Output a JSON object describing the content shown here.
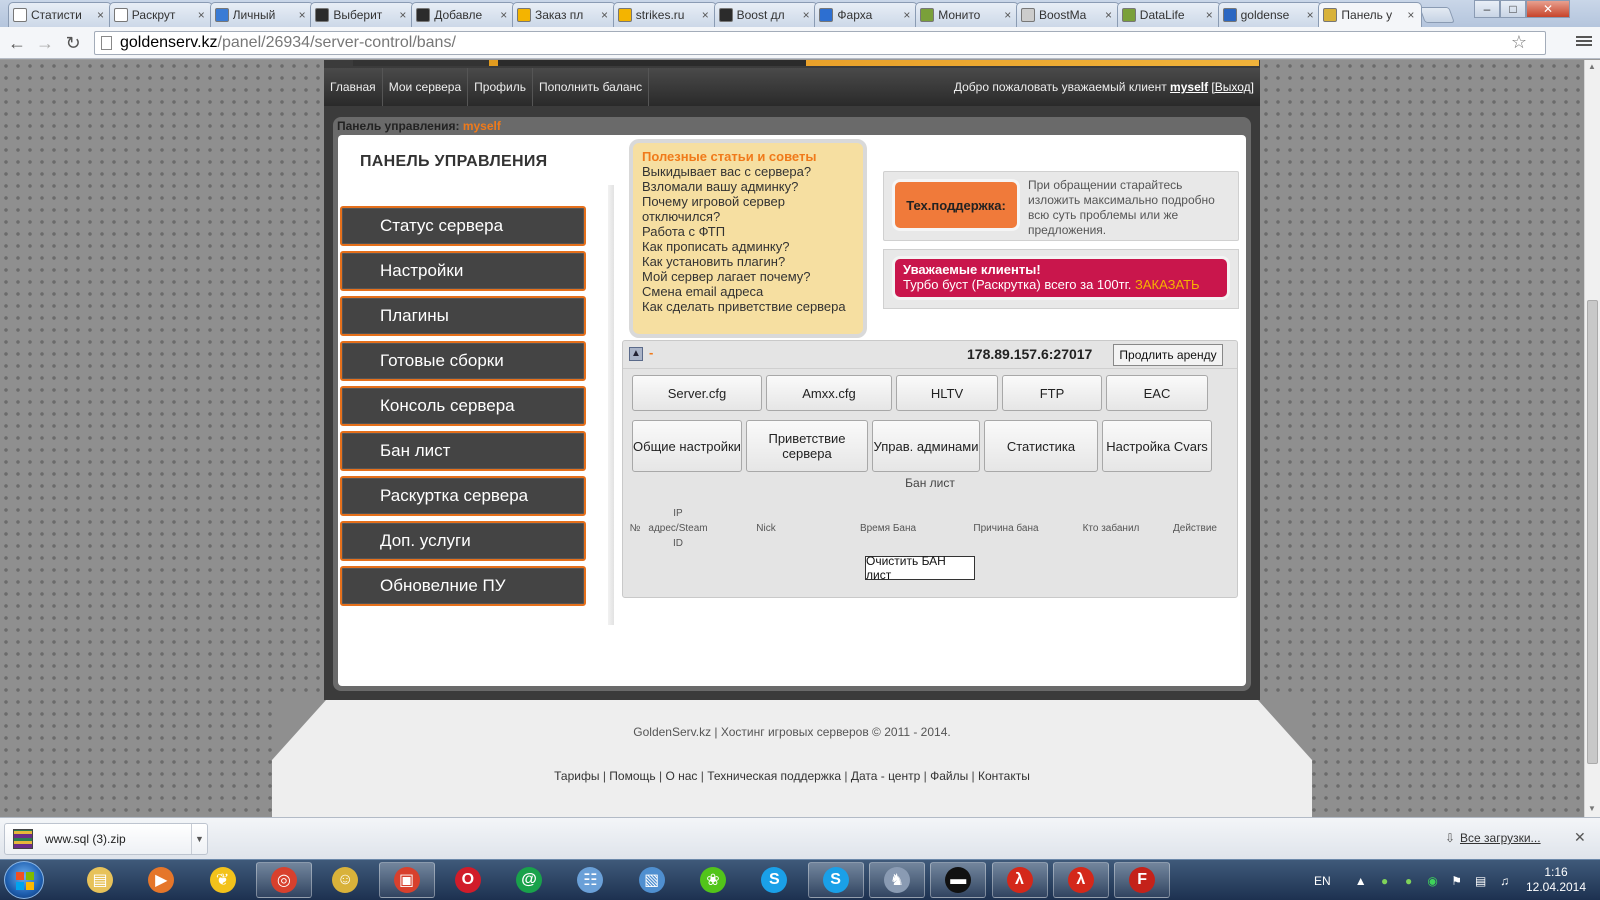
{
  "browser": {
    "tabs": [
      {
        "title": "Статисти",
        "fav": "page-icon",
        "color": "#ffffff"
      },
      {
        "title": "Раскрут",
        "fav": "page-icon",
        "color": "#ffffff"
      },
      {
        "title": "Личный",
        "fav": "folder-icon",
        "color": "#3a7bd5"
      },
      {
        "title": "Выберит",
        "fav": "cs-icon",
        "color": "#2b2b2b"
      },
      {
        "title": "Добавле",
        "fav": "cs-icon",
        "color": "#2b2b2b"
      },
      {
        "title": "Заказ пл",
        "fav": "google-icon",
        "color": "#f4b400"
      },
      {
        "title": "strikes.ru",
        "fav": "google-icon",
        "color": "#f4b400"
      },
      {
        "title": "Boost дл",
        "fav": "cs-icon",
        "color": "#2b2b2b"
      },
      {
        "title": "Фарха",
        "fav": "play-icon",
        "color": "#2d6fd1"
      },
      {
        "title": "Монито",
        "fav": "cs-green-icon",
        "color": "#7aa03a"
      },
      {
        "title": "BoostMa",
        "fav": "loading-icon",
        "color": "#cccccc"
      },
      {
        "title": "DataLife",
        "fav": "cs-green-icon",
        "color": "#7aa03a"
      },
      {
        "title": "goldense",
        "fav": "gs-icon",
        "color": "#2b67c2"
      },
      {
        "title": "Панель у",
        "fav": "cs-icon",
        "color": "#d8b23a"
      }
    ],
    "url_host": "goldenserv.kz",
    "url_path": "/panel/26934/server-control/bans/"
  },
  "site": {
    "nav": [
      "Главная",
      "Мои сервера",
      "Профиль",
      "Пополнить баланс"
    ],
    "welcome": "Добро пожаловать уважаемый клиент",
    "username": "myself",
    "logout": "[Выход]",
    "panel_header": "Панель управления:",
    "panel_user": "myself",
    "cp_title": "ПАНЕЛЬ УПРАВЛЕНИЯ",
    "side_menu": [
      "Статус сервера",
      "Настройки",
      "Плагины",
      "Готовые сборки",
      "Консоль сервера",
      "Бан лист",
      "Раскуртка сервера",
      "Доп. услуги",
      "Обновелние ПУ"
    ],
    "tips_title": "Полезные статьи и советы",
    "tips": [
      "Выкидывает вас с сервера?",
      "Взломали вашу админку?",
      "Почему игровой сервер отключился?",
      "Работа с ФТП",
      "Как прописать админку?",
      "Как установить плагин?",
      "Мой сервер лагает почему?",
      "Смена email адреса",
      "Как сделать приветствие сервера"
    ],
    "support_label": "Тех.поддержка:",
    "support_text": "При обращении старайтесь изложить максимально подробно всю суть проблемы или же предложения.",
    "promo_title": "Уважаемые клиенты!",
    "promo_text": "Турбо буст (Раскрутка) всего за 100тг.",
    "promo_order": "ЗАКАЗАТЬ",
    "server_dash": "-",
    "server_ip": "178.89.157.6:27017",
    "renew": "Продлить аренду",
    "row1": [
      "Server.cfg",
      "Amxx.cfg",
      "HLTV",
      "FTP",
      "EAC"
    ],
    "row2": [
      "Общие настройки",
      "Приветствие сервера",
      "Управ. админами",
      "Статистика",
      "Настройка Cvars"
    ],
    "banlist_title": "Бан лист",
    "ban_columns": [
      "№",
      "IP адрес/Steam ID",
      "Nick",
      "Время Бана",
      "Причина бана",
      "Кто забанил",
      "Действие"
    ],
    "clear_btn": "Очистить БАН лист",
    "copyright": "GoldenServ.kz | Хостинг игровых серверов © 2011 - 2014.",
    "footer_links": [
      "Тарифы",
      "Помощь",
      "О нас",
      "Техническая поддержка",
      "Дата - центр",
      "Файлы",
      "Контакты"
    ],
    "accent": "#f07a1a",
    "promo_color": "#c9164c",
    "support_color": "#f07a3a"
  },
  "downloads": {
    "file": "www.sql (3).zip",
    "all": "Все загрузки..."
  },
  "taskbar": {
    "apps": [
      "explorer-icon",
      "media-player-icon",
      "bird-icon",
      "chrome-icon",
      "alien-icon",
      "game-icon",
      "opera-icon",
      "mail-ru-agent-icon",
      "network-icon",
      "remote-icon",
      "icq-icon",
      "skype-icon",
      "skype-icon-2",
      "cs-icon",
      "cmd-icon",
      "hl-icon",
      "hl-icon-2",
      "filezilla-icon"
    ],
    "lang": "EN",
    "time": "1:16",
    "date": "12.04.2014"
  }
}
